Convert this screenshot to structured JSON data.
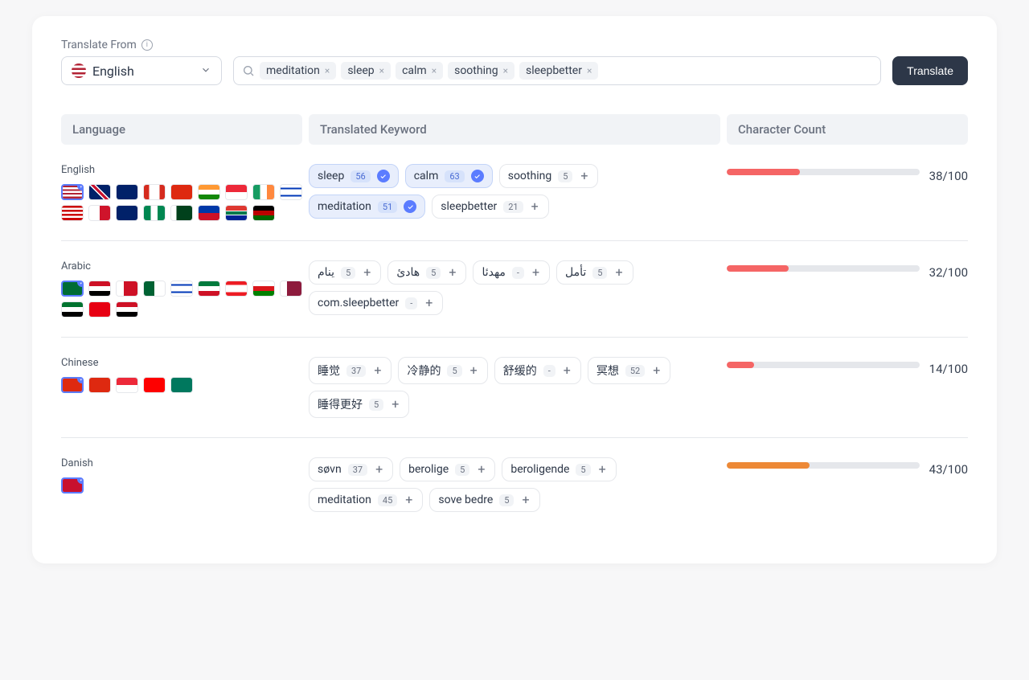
{
  "topLabel": "Translate From",
  "sourceLanguage": "English",
  "translateButton": "Translate",
  "inputKeywords": [
    "meditation",
    "sleep",
    "calm",
    "soothing",
    "sleepbetter"
  ],
  "columns": {
    "language": "Language",
    "keyword": "Translated Keyword",
    "count": "Character Count"
  },
  "rows": [
    {
      "language": "English",
      "flags": [
        {
          "code": "us",
          "selected": true
        },
        {
          "code": "gb"
        },
        {
          "code": "au"
        },
        {
          "code": "ca"
        },
        {
          "code": "hk"
        },
        {
          "code": "in"
        },
        {
          "code": "sg"
        },
        {
          "code": "ie"
        },
        {
          "code": "il"
        },
        {
          "code": "my"
        },
        {
          "code": "mt"
        },
        {
          "code": "nz"
        },
        {
          "code": "ng"
        },
        {
          "code": "pk"
        },
        {
          "code": "ph"
        },
        {
          "code": "za"
        },
        {
          "code": "ke"
        }
      ],
      "keywords": [
        {
          "text": "sleep",
          "badge": "56",
          "selected": true
        },
        {
          "text": "calm",
          "badge": "63",
          "selected": true
        },
        {
          "text": "soothing",
          "badge": "5",
          "selected": false
        },
        {
          "text": "meditation",
          "badge": "51",
          "selected": true
        },
        {
          "text": "sleepbetter",
          "badge": "21",
          "selected": false
        }
      ],
      "count": 38,
      "max": 100,
      "barColor": "red"
    },
    {
      "language": "Arabic",
      "flags": [
        {
          "code": "sa",
          "selected": true
        },
        {
          "code": "eg"
        },
        {
          "code": "bh"
        },
        {
          "code": "dz"
        },
        {
          "code": "il"
        },
        {
          "code": "kw"
        },
        {
          "code": "lb"
        },
        {
          "code": "om"
        },
        {
          "code": "qa"
        },
        {
          "code": "ae"
        },
        {
          "code": "tn"
        },
        {
          "code": "iq"
        }
      ],
      "keywords": [
        {
          "text": "ينام",
          "badge": "5",
          "selected": false
        },
        {
          "text": "هادئ",
          "badge": "5",
          "selected": false
        },
        {
          "text": "مهدئا",
          "badge": "-",
          "selected": false
        },
        {
          "text": "تأمل",
          "badge": "5",
          "selected": false
        },
        {
          "text": "com.sleepbetter",
          "badge": "-",
          "selected": false
        }
      ],
      "count": 32,
      "max": 100,
      "barColor": "red"
    },
    {
      "language": "Chinese",
      "flags": [
        {
          "code": "cn",
          "selected": true
        },
        {
          "code": "hk"
        },
        {
          "code": "sg"
        },
        {
          "code": "tw"
        },
        {
          "code": "mo"
        }
      ],
      "keywords": [
        {
          "text": "睡觉",
          "badge": "37",
          "selected": false
        },
        {
          "text": "冷静的",
          "badge": "5",
          "selected": false
        },
        {
          "text": "舒缓的",
          "badge": "-",
          "selected": false
        },
        {
          "text": "冥想",
          "badge": "52",
          "selected": false
        },
        {
          "text": "睡得更好",
          "badge": "5",
          "selected": false
        }
      ],
      "count": 14,
      "max": 100,
      "barColor": "red"
    },
    {
      "language": "Danish",
      "flags": [
        {
          "code": "dk",
          "selected": true
        }
      ],
      "keywords": [
        {
          "text": "søvn",
          "badge": "37",
          "selected": false
        },
        {
          "text": "berolige",
          "badge": "5",
          "selected": false
        },
        {
          "text": "beroligende",
          "badge": "5",
          "selected": false
        },
        {
          "text": "meditation",
          "badge": "45",
          "selected": false
        },
        {
          "text": "sove bedre",
          "badge": "5",
          "selected": false
        }
      ],
      "count": 43,
      "max": 100,
      "barColor": "orange"
    }
  ],
  "flagColors": {
    "us": "linear-gradient(#b22234 0 14%,#fff 14% 28%,#b22234 28% 42%,#fff 42% 56%,#b22234 56% 70%,#fff 70% 84%,#b22234 84%)",
    "gb": "linear-gradient(45deg,#012169 40%,#fff 40% 45%,#c8102e 45% 55%,#fff 55% 60%,#012169 60%)",
    "au": "linear-gradient(#012169,#012169)",
    "ca": "linear-gradient(90deg,#d52b1e 0 25%,#fff 25% 75%,#d52b1e 75%)",
    "hk": "linear-gradient(#de2910,#de2910)",
    "in": "linear-gradient(#ff9933 0 33%,#fff 33% 66%,#138808 66%)",
    "sg": "linear-gradient(#ed2939 0 50%,#fff 50%)",
    "ie": "linear-gradient(90deg,#169b62 0 33%,#fff 33% 66%,#ff883e 66%)",
    "il": "linear-gradient(#fff 0 20%,#0038b8 20% 30%,#fff 30% 70%,#0038b8 70% 80%,#fff 80%)",
    "my": "linear-gradient(#cc0001 0 14%,#fff 14% 28%,#cc0001 28% 42%,#fff 42% 56%,#cc0001 56% 70%,#fff 70% 84%,#cc0001 84%)",
    "mt": "linear-gradient(90deg,#fff 0 50%,#cf142b 50%)",
    "nz": "linear-gradient(#012169,#012169)",
    "ng": "linear-gradient(90deg,#008751 0 33%,#fff 33% 66%,#008751 66%)",
    "pk": "linear-gradient(90deg,#fff 0 25%,#01411c 25%)",
    "ph": "linear-gradient(#0038a8 0 50%,#ce1126 50%)",
    "za": "linear-gradient(#de3831 0 33%,#fff 33% 40%,#007a4d 40% 60%,#fff 60% 67%,#002395 67%)",
    "ke": "linear-gradient(#000 0 33%,#b00 33% 66%,#060 66%)",
    "sa": "linear-gradient(#006c35,#006c35)",
    "eg": "linear-gradient(#ce1126 0 33%,#fff 33% 66%,#000 66%)",
    "bh": "linear-gradient(90deg,#fff 0 35%,#ce1126 35%)",
    "dz": "linear-gradient(90deg,#006233 0 50%,#fff 50%)",
    "kw": "linear-gradient(#007a3d 0 33%,#fff 33% 66%,#ce1126 66%)",
    "lb": "linear-gradient(#ed1c24 0 25%,#fff 25% 75%,#ed1c24 75%)",
    "om": "linear-gradient(#fff 0 33%,#db161b 33% 66%,#008000 66%)",
    "qa": "linear-gradient(90deg,#fff 0 30%,#8d1b3d 30%)",
    "ae": "linear-gradient(#00732f 0 33%,#fff 33% 66%,#000 66%)",
    "tn": "linear-gradient(#e70013,#e70013)",
    "iq": "linear-gradient(#ce1126 0 33%,#fff 33% 66%,#000 66%)",
    "cn": "linear-gradient(#de2910,#de2910)",
    "tw": "linear-gradient(#fe0000,#fe0000)",
    "mo": "linear-gradient(#00785e,#00785e)",
    "dk": "linear-gradient(#c8102e,#c8102e)"
  }
}
